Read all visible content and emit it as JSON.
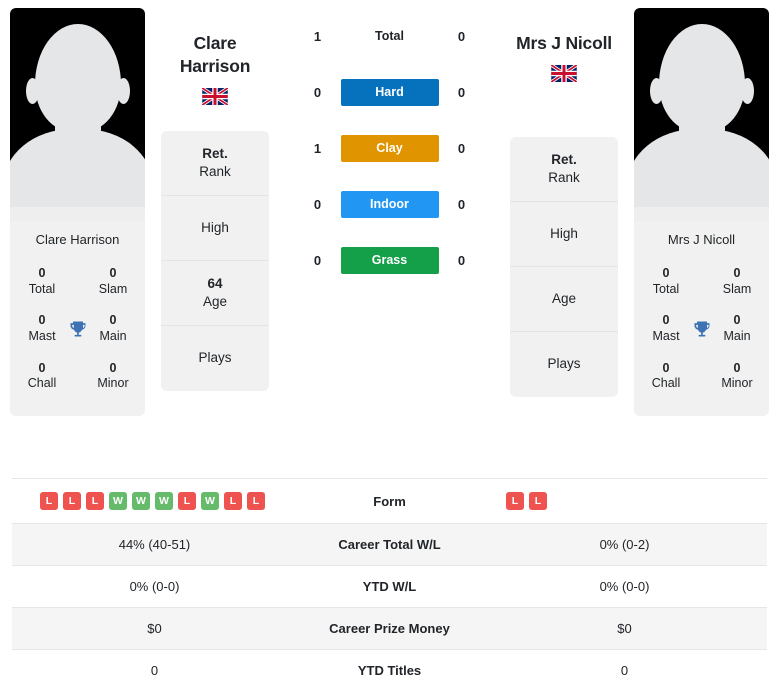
{
  "players": {
    "left": {
      "name": "Clare Harrison",
      "name_line1": "Clare",
      "name_line2": "Harrison",
      "flag": "gb-flag-icon",
      "avatar": "player-avatar-placeholder",
      "titles": [
        {
          "value": "0",
          "label": "Total"
        },
        {
          "value": "0",
          "label": "Slam"
        },
        {
          "value": "0",
          "label": "Mast"
        },
        {
          "value": "0",
          "label": "Main"
        },
        {
          "value": "0",
          "label": "Chall"
        },
        {
          "value": "0",
          "label": "Minor"
        }
      ],
      "info": [
        {
          "value": "Ret.",
          "label": "Rank"
        },
        {
          "value": "",
          "label": "High"
        },
        {
          "value": "64",
          "label": "Age"
        },
        {
          "value": "",
          "label": "Plays"
        }
      ],
      "form": [
        "L",
        "L",
        "L",
        "W",
        "W",
        "W",
        "L",
        "W",
        "L",
        "L"
      ],
      "career_total_wl": "44% (40-51)",
      "ytd_wl": "0% (0-0)",
      "career_prize_money": "$0",
      "ytd_titles": "0"
    },
    "right": {
      "name": "Mrs J Nicoll",
      "name_line1": "Mrs J Nicoll",
      "name_line2": "",
      "flag": "gb-flag-icon",
      "avatar": "player-avatar-placeholder",
      "titles": [
        {
          "value": "0",
          "label": "Total"
        },
        {
          "value": "0",
          "label": "Slam"
        },
        {
          "value": "0",
          "label": "Mast"
        },
        {
          "value": "0",
          "label": "Main"
        },
        {
          "value": "0",
          "label": "Chall"
        },
        {
          "value": "0",
          "label": "Minor"
        }
      ],
      "info": [
        {
          "value": "Ret.",
          "label": "Rank"
        },
        {
          "value": "",
          "label": "High"
        },
        {
          "value": "",
          "label": "Age"
        },
        {
          "value": "",
          "label": "Plays"
        }
      ],
      "form": [
        "L",
        "L"
      ],
      "career_total_wl": "0% (0-2)",
      "ytd_wl": "0% (0-0)",
      "career_prize_money": "$0",
      "ytd_titles": "0"
    }
  },
  "head_to_head": {
    "rows": [
      {
        "key": "total",
        "label": "Total",
        "left": "1",
        "right": "0",
        "badge": false,
        "color": ""
      },
      {
        "key": "hard",
        "label": "Hard",
        "left": "0",
        "right": "0",
        "badge": true,
        "color": "#0672bd"
      },
      {
        "key": "clay",
        "label": "Clay",
        "left": "1",
        "right": "0",
        "badge": true,
        "color": "#e09400"
      },
      {
        "key": "indoor",
        "label": "Indoor",
        "left": "0",
        "right": "0",
        "badge": true,
        "color": "#2196f3"
      },
      {
        "key": "grass",
        "label": "Grass",
        "left": "0",
        "right": "0",
        "badge": true,
        "color": "#13a049"
      }
    ]
  },
  "stats_table": {
    "rows": [
      {
        "key": "form",
        "label": "Form"
      },
      {
        "key": "career_total_wl",
        "label": "Career Total W/L"
      },
      {
        "key": "ytd_wl",
        "label": "YTD W/L"
      },
      {
        "key": "career_prize_money",
        "label": "Career Prize Money"
      },
      {
        "key": "ytd_titles",
        "label": "YTD Titles"
      }
    ]
  },
  "icons": {
    "trophy": "trophy-icon",
    "flag": "gb-flag-icon"
  },
  "colors": {
    "hard": "#0672bd",
    "clay": "#e09400",
    "indoor": "#2196f3",
    "grass": "#13a049",
    "win": "#66bb6a",
    "loss": "#ef5350",
    "card_bg": "#f1f1f1",
    "stripe": "#f5f5f5"
  }
}
